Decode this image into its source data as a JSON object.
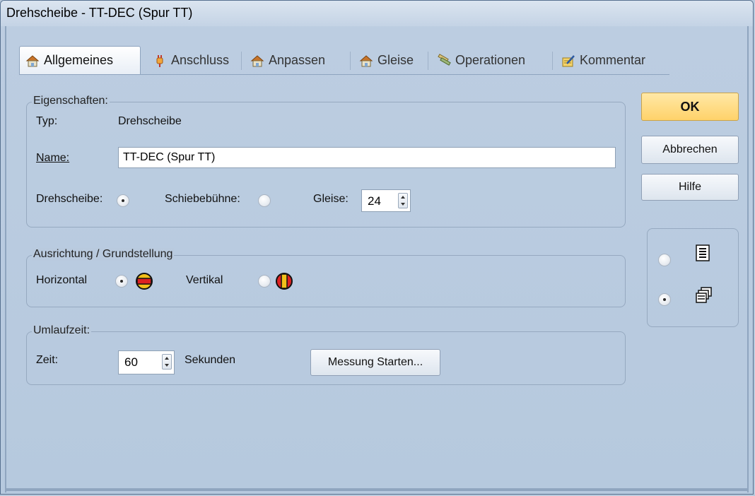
{
  "window": {
    "title": "Drehscheibe - TT-DEC (Spur TT)"
  },
  "tabs": [
    {
      "label": "Allgemeines",
      "icon": "house-icon"
    },
    {
      "label": "Anschluss",
      "icon": "plug-icon"
    },
    {
      "label": "Anpassen",
      "icon": "house-icon"
    },
    {
      "label": "Gleise",
      "icon": "house-icon"
    },
    {
      "label": "Operationen",
      "icon": "tools-icon"
    },
    {
      "label": "Kommentar",
      "icon": "notepad-pen-icon"
    }
  ],
  "properties": {
    "group_label": "Eigenschaften:",
    "type_label": "Typ:",
    "type_value": "Drehscheibe",
    "name_label": "Name:",
    "name_value": "TT-DEC (Spur TT)",
    "turntable_label": "Drehscheibe:",
    "traverser_label": "Schiebebühne:",
    "tracks_label": "Gleise:",
    "tracks_value": "24",
    "turntable_selected": true,
    "traverser_selected": false
  },
  "orientation": {
    "group_label": "Ausrichtung / Grundstellung",
    "horizontal_label": "Horizontal",
    "vertical_label": "Vertikal",
    "horizontal_selected": true,
    "vertical_selected": false
  },
  "rotation_time": {
    "group_label": "Umlaufzeit:",
    "time_label": "Zeit:",
    "time_value": "60",
    "unit": "Sekunden",
    "measure_button": "Messung Starten..."
  },
  "buttons": {
    "ok": "OK",
    "cancel": "Abbrechen",
    "help": "Hilfe"
  },
  "view_options": {
    "list_selected": false,
    "tiles_selected": true,
    "list_icon": "list-view-icon",
    "tiles_icon": "stacked-windows-icon"
  },
  "colors": {
    "ok_button": "#ffd26a",
    "dialog_bg": "#b9c9dc"
  }
}
